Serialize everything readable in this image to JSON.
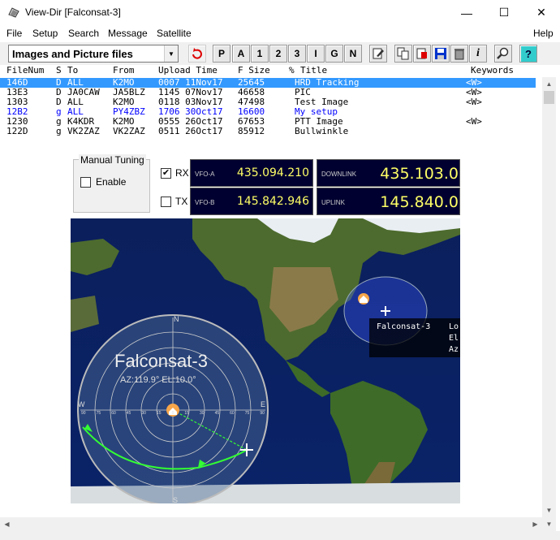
{
  "window": {
    "title": "View-Dir [Falconsat-3]",
    "minimize": "—",
    "maximize": "☐",
    "close": "✕"
  },
  "menu": {
    "file": "File",
    "setup": "Setup",
    "search": "Search",
    "message": "Message",
    "satellite": "Satellite",
    "help": "Help"
  },
  "toolbar": {
    "filter": "Images and Picture files",
    "letter_buttons": [
      "P",
      "A",
      "1",
      "2",
      "3",
      "I",
      "G",
      "N"
    ]
  },
  "table": {
    "headers": {
      "filenum": "FileNum",
      "s": "S",
      "to": "To",
      "from": "From",
      "upload_time": "Upload Time",
      "fsize": "F Size",
      "pct": "%",
      "title": "Title",
      "keywords": "Keywords"
    },
    "rows": [
      {
        "filenum": "146D",
        "s": "D",
        "to": "ALL",
        "from": "K2MO",
        "upload": "0007 11Nov17",
        "size": "25645",
        "title": "HRD Tracking",
        "keywords": "<W>"
      },
      {
        "filenum": "13E3",
        "s": "D",
        "to": "JA0CAW",
        "from": "JA5BLZ",
        "upload": "1145 07Nov17",
        "size": "46658",
        "title": "PIC",
        "keywords": "<W>"
      },
      {
        "filenum": "1303",
        "s": "D",
        "to": "ALL",
        "from": "K2MO",
        "upload": "0118 03Nov17",
        "size": "47498",
        "title": "Test Image",
        "keywords": "<W>"
      },
      {
        "filenum": "12B2",
        "s": "g",
        "to": "ALL",
        "from": "PY4ZBZ",
        "upload": "1706 30Oct17",
        "size": "16600",
        "title": "My setup",
        "keywords": ""
      },
      {
        "filenum": "1230",
        "s": "g",
        "to": "K4KDR",
        "from": "K2MO",
        "upload": "0555 26Oct17",
        "size": "67653",
        "title": "PTT Image",
        "keywords": "<W>"
      },
      {
        "filenum": "122D",
        "s": "g",
        "to": "VK2ZAZ",
        "from": "VK2ZAZ",
        "upload": "0511 26Oct17",
        "size": "85912",
        "title": "Bullwinkle",
        "keywords": ""
      }
    ]
  },
  "tuning": {
    "legend": "Manual Tuning",
    "enable_label": "Enable",
    "rx_label": "RX",
    "tx_label": "TX",
    "rx_checked": "✔",
    "vfo_a_label": "VFO-A",
    "vfo_a_value": "435.094.210",
    "vfo_b_label": "VFO-B",
    "vfo_b_value": "145.842.946",
    "downlink_label": "DOWNLINK",
    "downlink_value": "435.103.0",
    "uplink_label": "UPLINK",
    "uplink_value": "145.840.0"
  },
  "map": {
    "satellite_name": "Falconsat-3",
    "az_el": "AZ:119.9°  EL:10.0°",
    "popup_name": "Falconsat-3",
    "popup_lines": [
      "Lo",
      "El",
      "Az"
    ],
    "compass": {
      "n": "N",
      "s": "S",
      "e": "E",
      "w": "W"
    },
    "elevation_ticks": [
      "90",
      "75",
      "60",
      "45",
      "30",
      "15",
      "0",
      "15",
      "30",
      "45",
      "60",
      "75",
      "90"
    ]
  },
  "colors": {
    "selection": "#3399ff",
    "panel_bg": "#000030",
    "vfo_text": "#ffff66",
    "track": "#33ff33"
  }
}
